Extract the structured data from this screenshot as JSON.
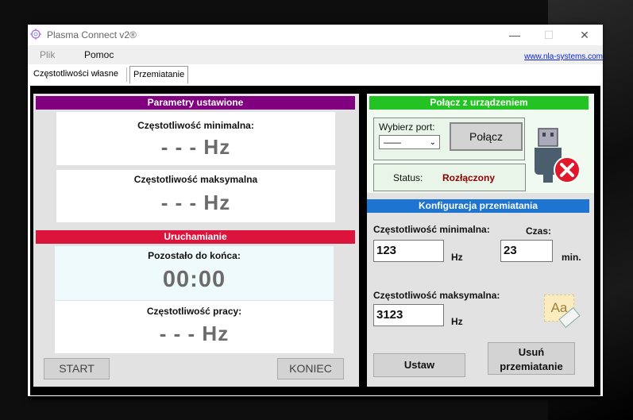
{
  "window": {
    "title": "Plasma Connect  v2®"
  },
  "controls": {
    "minimize": "—",
    "maximize": "☐",
    "close": "✕"
  },
  "menu": {
    "items": [
      "Plik",
      "Pomoc"
    ],
    "link": "www.nla-systems.com"
  },
  "tabs": [
    {
      "label": "Częstotliwości własne",
      "active": false
    },
    {
      "label": "Przemiatanie",
      "active": true
    }
  ],
  "left": {
    "params_header": "Parametry ustawione",
    "params_header_color": "#800080",
    "min_label": "Częstotliwość minimalna:",
    "min_value": "- - - Hz",
    "max_label": "Częstotliwość maksymalna",
    "max_value": "- - - Hz",
    "run_header": "Uruchamianie",
    "run_header_color": "#dc143c",
    "remaining_label": "Pozostało do końca:",
    "remaining_value": "00:00",
    "work_label": "Częstotliwość pracy:",
    "work_value": "- - - Hz",
    "start_button": "START",
    "end_button": "KONIEC"
  },
  "right": {
    "connect_header": "Połącz z urządzeniem",
    "connect_header_color": "#22c322",
    "port_label": "Wybierz port:",
    "port_value": "——",
    "connect_button": "Połącz",
    "status_label": "Status:",
    "status_value": "Rozłączony",
    "status_color": "#8b0000",
    "usb_icon": "usb-disconnected-icon",
    "config_header": "Konfiguracja przemiatania",
    "config_header_color": "#1e74d1",
    "min_label": "Częstotliwość minimalna:",
    "min_value": "123",
    "min_unit": "Hz",
    "time_label": "Czas:",
    "time_value": "23",
    "time_unit": "min.",
    "max_label": "Częstotliwość maksymalna:",
    "max_value": "3123",
    "max_unit": "Hz",
    "eraser_icon": "clear-text-icon",
    "eraser_text": "Aa",
    "set_button": "Ustaw",
    "remove_button_line1": "Usuń",
    "remove_button_line2": "przemiatanie"
  }
}
